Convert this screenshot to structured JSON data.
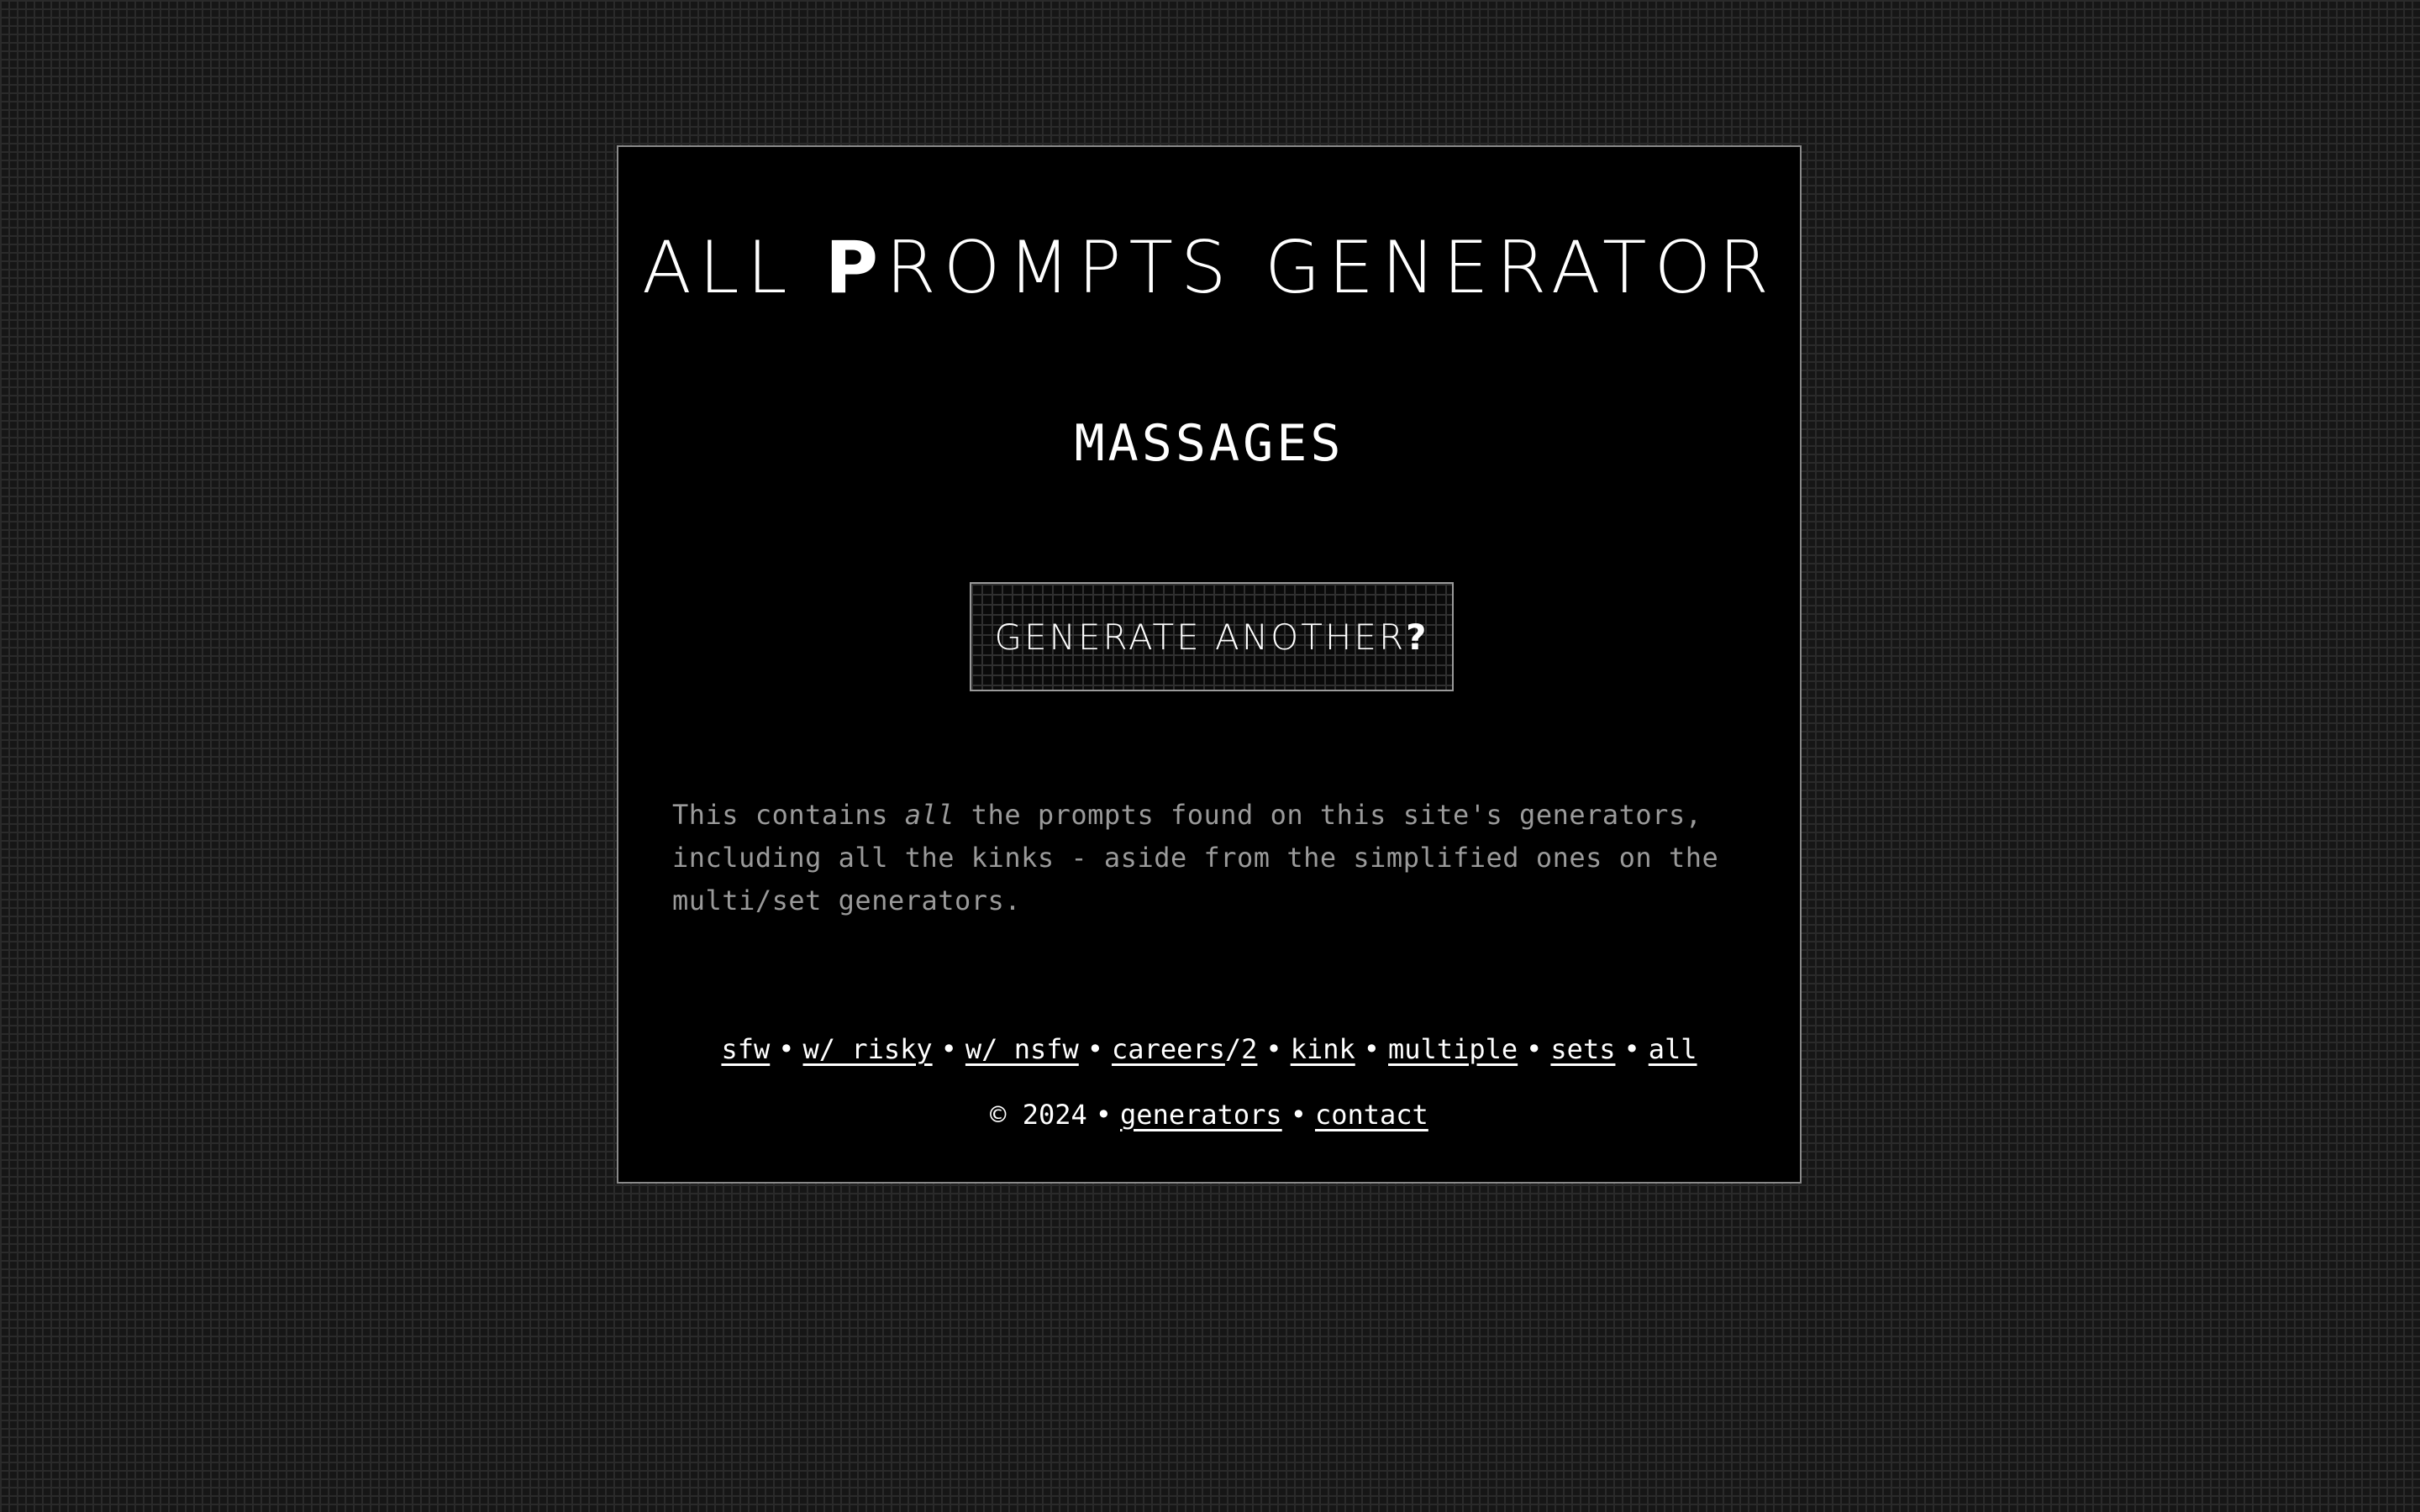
{
  "header": {
    "title_part1": "ALL ",
    "title_heavy": "P",
    "title_part2": "ROMPTS GENERATOR"
  },
  "result": {
    "prompt": "MASSAGES"
  },
  "button": {
    "label": "GENERATE ANOTHER",
    "label_heavy": "?"
  },
  "description": {
    "part1": "This contains ",
    "emphasis": "all",
    "part2": " the prompts found on this site's generators, including all the kinks - aside from the simplified ones on the multi/set generators."
  },
  "nav": {
    "links": [
      "sfw",
      "w/ risky",
      "w/ nsfw",
      "careers",
      "2",
      "kink",
      "multiple",
      "sets",
      "all"
    ],
    "separator": "•",
    "slash": "/"
  },
  "footer": {
    "copyright": "© 2024",
    "links": [
      "generators",
      "contact"
    ],
    "separator": "•"
  },
  "colors": {
    "background": "#161616",
    "card": "#000000",
    "text": "#ffffff",
    "muted_text": "#9a9a9a",
    "border": "#8a8a8a"
  }
}
